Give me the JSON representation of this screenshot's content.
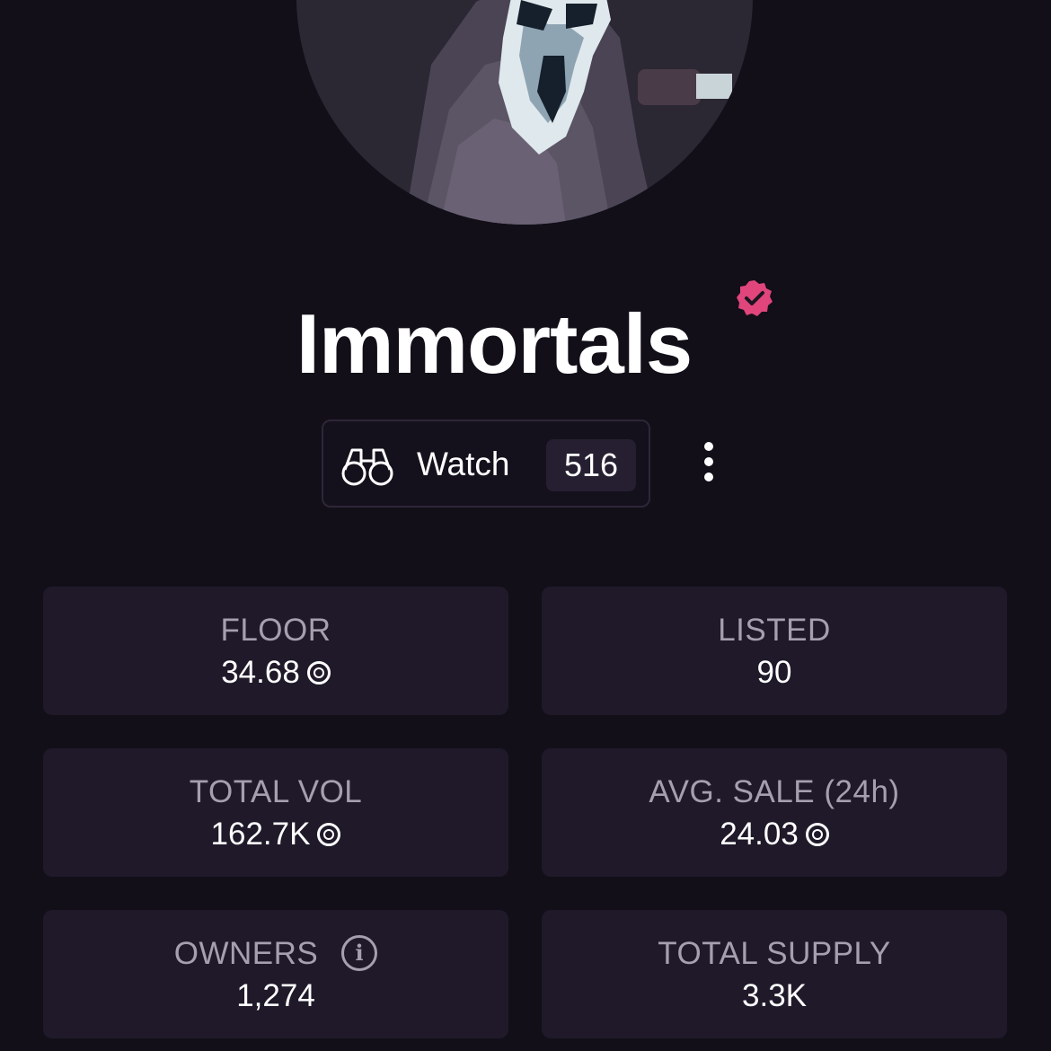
{
  "collection": {
    "name": "Immortals",
    "verified": true,
    "avatar_description_icon": "ghostface-pixel-art-avatar"
  },
  "watch": {
    "label": "Watch",
    "count": "516",
    "icon": "binoculars-icon"
  },
  "more_icon": "vertical-ellipsis-icon",
  "colors": {
    "background": "#120f19",
    "card": "#1f1929",
    "verified_badge": "#e0457b",
    "label_text": "#a59fb0"
  },
  "stats": {
    "floor": {
      "label": "FLOOR",
      "value": "34.68"
    },
    "listed": {
      "label": "LISTED",
      "value": "90"
    },
    "total_vol": {
      "label": "TOTAL VOL",
      "value": "162.7K"
    },
    "avg_sale": {
      "label": "AVG. SALE (24h)",
      "value": "24.03"
    },
    "owners": {
      "label": "OWNERS",
      "value": "1,274"
    },
    "total_supply": {
      "label": "TOTAL SUPPLY",
      "value": "3.3K"
    }
  }
}
